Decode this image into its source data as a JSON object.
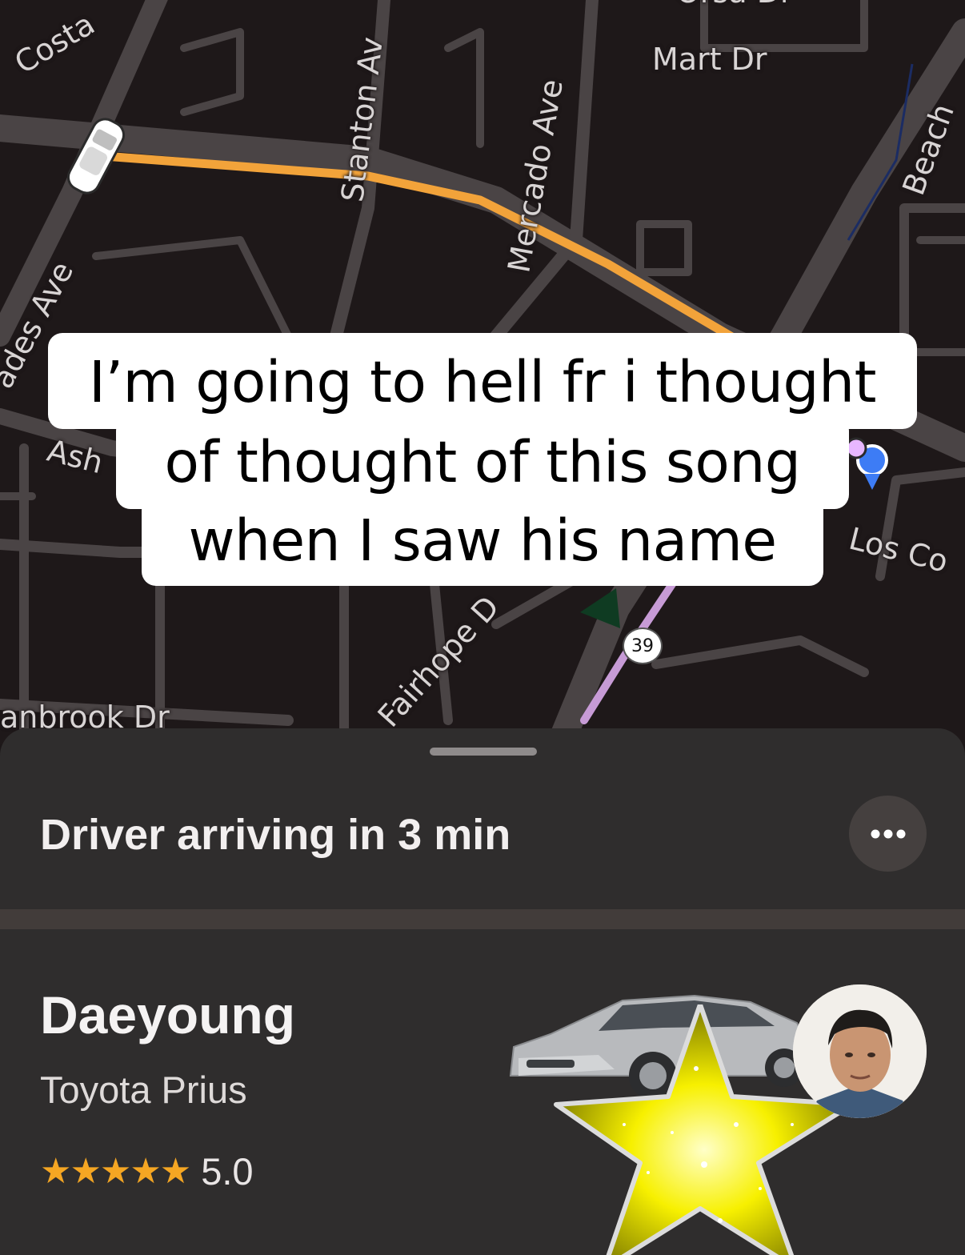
{
  "map": {
    "streets": {
      "costa": "Costa",
      "stanton": "Stanton Av",
      "mercado": "Mercado Ave",
      "mart": "Mart Dr",
      "beach": "Beach",
      "andes": "ades Ave",
      "ash": "Ash",
      "fairhope": "Fairhope D",
      "los_co": "Los Co",
      "canbrook": "anbrook Dr",
      "orsa": "Orsa Dr"
    },
    "route_shield": "39",
    "colors": {
      "route": "#f2a33a",
      "highway": "#c79bd6",
      "streets": "#4a4445",
      "pickup_pin": "#3d7cf5"
    }
  },
  "caption": {
    "line1": "I’m going to hell fr i thought",
    "line2": "of thought of this song",
    "line3": "when I saw his name"
  },
  "sheet": {
    "eta": "Driver arriving in 3 min",
    "more_icon": "ellipsis-icon",
    "driver": {
      "name": "Daeyoung",
      "car": "Toyota Prius",
      "stars": "★★★★★",
      "rating": "5.0"
    }
  }
}
